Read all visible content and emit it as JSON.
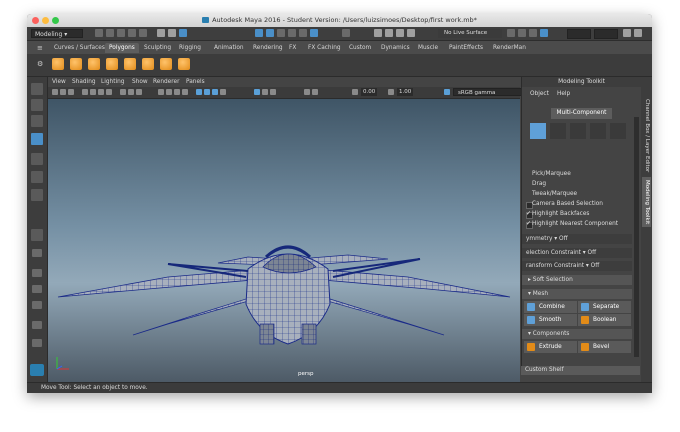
{
  "window": {
    "title": "Autodesk Maya 2016 - Student Version: /Users/luizsimoes/Desktop/first work.mb*",
    "traffic_lights": [
      "#fc615d",
      "#fdbc40",
      "#34c84a"
    ]
  },
  "status_line": {
    "mode": "Modeling",
    "live_surface": "No Live Surface"
  },
  "shelf_tabs": [
    "Curves / Surfaces",
    "Polygons",
    "Sculpting",
    "Rigging",
    "Animation",
    "Rendering",
    "FX",
    "FX Caching",
    "Custom",
    "Dynamics",
    "Muscle",
    "PaintEffects",
    "RenderMan"
  ],
  "shelf_active_tab": "Polygons",
  "panel_menu": [
    "View",
    "Shading",
    "Lighting",
    "Show",
    "Renderer",
    "Panels"
  ],
  "panel_toolbar": {
    "value_a": "0.00",
    "value_b": "1.00",
    "color_space": "sRGB gamma"
  },
  "viewport": {
    "camera_label": "persp"
  },
  "modeling_toolkit": {
    "title": "Modeling Toolkit",
    "menu": [
      "Object",
      "Help"
    ],
    "multi_component": "Multi-Component",
    "pick_options": [
      "Pick/Marquee",
      "Drag",
      "Tweak/Marquee"
    ],
    "checkboxes": [
      {
        "label": "Camera Based Selection",
        "checked": false
      },
      {
        "label": "Highlight Backfaces",
        "checked": true
      },
      {
        "label": "Highlight Nearest Component",
        "checked": true
      }
    ],
    "symmetry_label": "ymmetry",
    "symmetry_value": "Off",
    "selection_constraint_label": "election Constraint",
    "selection_constraint_value": "Off",
    "transform_constraint_label": "ransform Constraint",
    "transform_constraint_value": "Off",
    "soft_selection": "Soft Selection",
    "mesh_section": "Mesh",
    "mesh_buttons": [
      "Combine",
      "Separate",
      "Smooth",
      "Boolean"
    ],
    "components_section": "Components",
    "component_buttons": [
      "Extrude",
      "Bevel"
    ],
    "custom_shelf": "Custom Shelf"
  },
  "side_tabs": [
    "Channel Box / Layer Editor",
    "Modeling Toolkit"
  ],
  "help_line": "Move Tool: Select an object to move."
}
